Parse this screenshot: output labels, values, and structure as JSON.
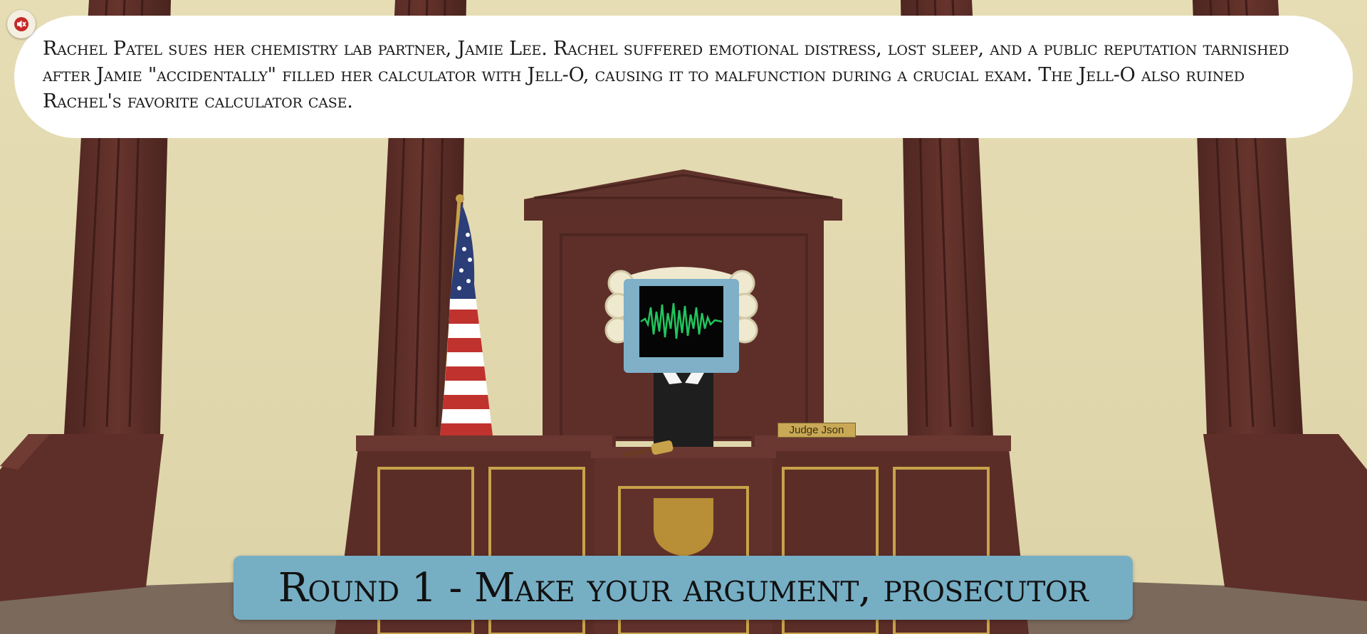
{
  "audio": {
    "mute_icon": "speaker-muted-icon"
  },
  "case": {
    "text": "Rachel Patel sues her chemistry lab partner, Jamie Lee. Rachel suffered emotional distress, lost sleep, and a public reputation tarnished after Jamie \"accidentally\" filled her calculator with Jell-O, causing it to malfunction during a crucial exam. The Jell-O also ruined Rachel's favorite calculator case."
  },
  "judge": {
    "nameplate": "Judge Json",
    "screen_icon": "waveform-icon"
  },
  "round": {
    "title": "Round 1 - Make your argument, prosecutor"
  },
  "colors": {
    "wall": "#e2d9b0",
    "wood": "#5a2f28",
    "banner": "#76aec4",
    "waveform": "#22c55e",
    "wig": "#efe9cf"
  }
}
